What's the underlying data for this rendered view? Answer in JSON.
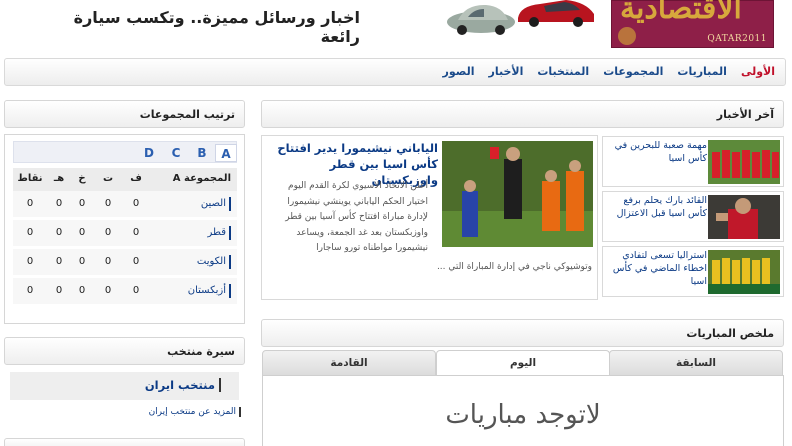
{
  "banner": {
    "ad_line1": "اخبار ورسائل مميزة.. وتكسب سيارة رائعة",
    "logo_text": "الاقتصادية",
    "logo_sub": "QATAR2011"
  },
  "nav": {
    "items": [
      "الأولى",
      "المباريات",
      "المجموعات",
      "المنتخبات",
      "الأخبار",
      "الصور"
    ]
  },
  "news": {
    "title": "آخر الأخبار",
    "main": {
      "headline": "الياباني نيشيمورا يدير افتتاح كأس اسيا بين قطر واوزبكستان",
      "body": "أعلن الاتحاد الاسيوي لكرة القدم اليوم اختيار الحكم الياباني يوينشي نيشيمورا لإدارة مباراة افتتاح كأس آسيا بين قطر واوزبكستان بعد غد الجمعة، ويساعد نيشيمورا مواطناه تورو ساجارا",
      "body2": "وتوشيوكي ناجي في إدارة المباراة التي ..."
    },
    "side": [
      {
        "text": "مهمة صعبة للبحرين في كأس اسيا"
      },
      {
        "text": "القائد بارك يحلم برفع كأس اسيا قبل الاعتزال"
      },
      {
        "text": "استراليا تسعى لتفادي اخطاء الماضي في كأس اسيا"
      }
    ]
  },
  "matches": {
    "title": "ملخص المباريات",
    "tabs": [
      "السابقة",
      "اليوم",
      "القادمة"
    ],
    "active_tab": "اليوم",
    "empty_text": "لاتوجد مباريات"
  },
  "groups": {
    "title": "ترتيب المجموعات",
    "tabs": [
      "A",
      "B",
      "C",
      "D"
    ],
    "active_tab": "A",
    "header": {
      "team": "المجموعة A",
      "p": "ف",
      "w": "ت",
      "d": "خ",
      "l": "هـ",
      "pts": "نقاط"
    },
    "rows": [
      {
        "team": "الصين",
        "p": "0",
        "w": "0",
        "d": "0",
        "l": "0",
        "pts": "0"
      },
      {
        "team": "قطر",
        "p": "0",
        "w": "0",
        "d": "0",
        "l": "0",
        "pts": "0"
      },
      {
        "team": "الكويت",
        "p": "0",
        "w": "0",
        "d": "0",
        "l": "0",
        "pts": "0"
      },
      {
        "team": "أزبكستان",
        "p": "0",
        "w": "0",
        "d": "0",
        "l": "0",
        "pts": "0"
      }
    ]
  },
  "profile": {
    "title": "سيرة منتخب",
    "team": "منتخب ايران",
    "more": "المزيد عن منتخب إيران"
  },
  "colors": {
    "link_blue": "#0b3a85",
    "nav_active": "#c0102a",
    "logo_bg": "#8e1f48"
  }
}
